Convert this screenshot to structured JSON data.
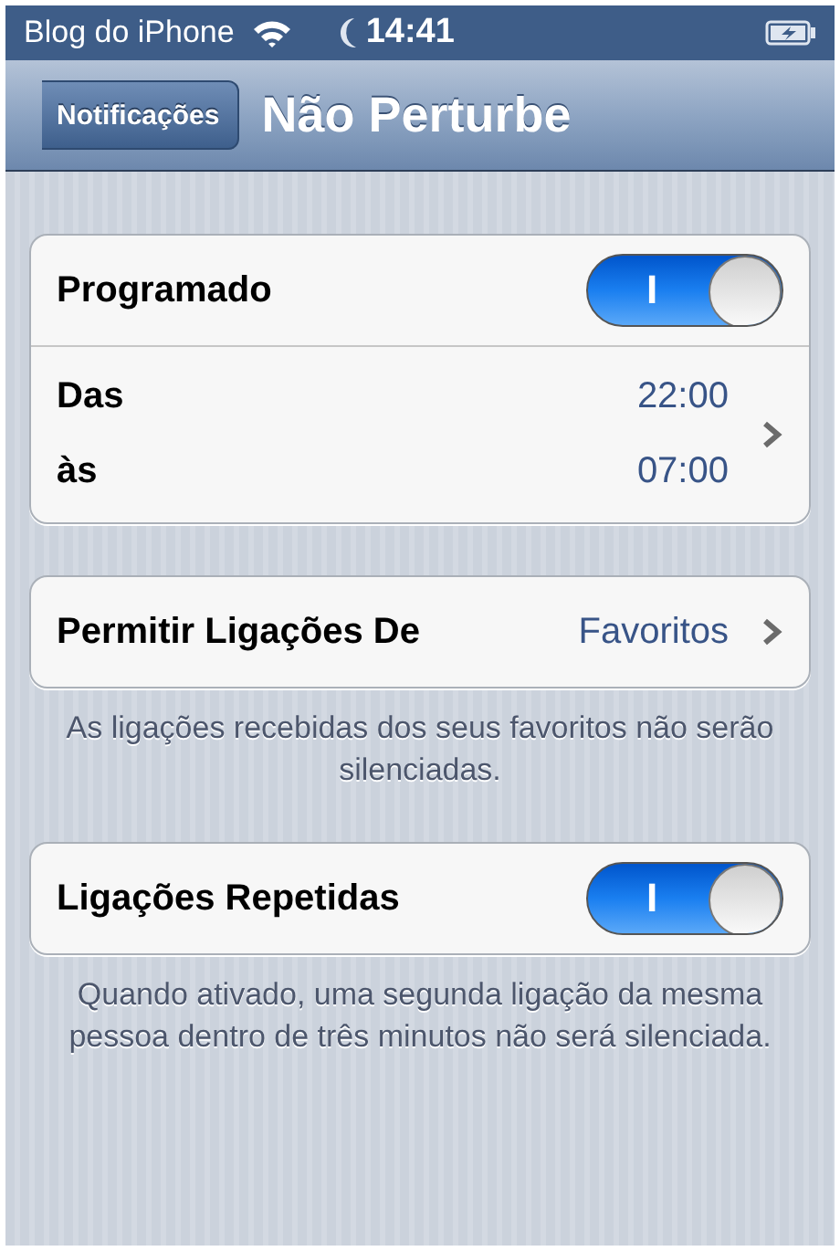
{
  "status_bar": {
    "carrier": "Blog do iPhone",
    "time": "14:41"
  },
  "nav_bar": {
    "back": "Notificações",
    "title": "Não Perturbe"
  },
  "groups": [
    {
      "rows": [
        {
          "kind": "switch",
          "label": "Programado",
          "on": true,
          "switch_text": "I"
        },
        {
          "kind": "times",
          "lines": [
            {
              "label": "Das",
              "value": "22:00"
            },
            {
              "label": "às",
              "value": "07:00"
            }
          ]
        }
      ]
    },
    {
      "rows": [
        {
          "kind": "detail",
          "label": "Permitir Ligações De",
          "value": "Favoritos"
        }
      ],
      "footer": "As ligações recebidas dos seus favoritos não serão silenciadas."
    },
    {
      "rows": [
        {
          "kind": "switch",
          "label": "Ligações Repetidas",
          "on": true,
          "switch_text": "I"
        }
      ],
      "footer": "Quando ativado, uma segunda ligação da mesma pessoa dentro de três minutos não será silenciada."
    }
  ]
}
